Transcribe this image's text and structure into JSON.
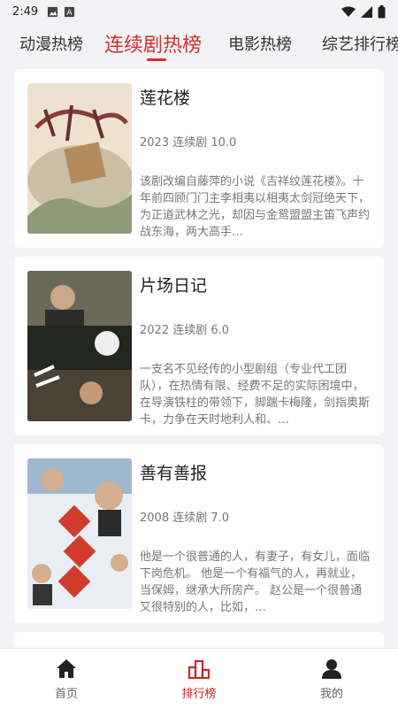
{
  "status_bar": {
    "time": "2:49",
    "icons": [
      "image-icon",
      "a-icon",
      "wifi-icon",
      "signal-icon",
      "battery-icon"
    ]
  },
  "tabs": [
    {
      "label": "动漫热榜",
      "active": false
    },
    {
      "label": "连续剧热榜",
      "active": true
    },
    {
      "label": "电影热榜",
      "active": false
    },
    {
      "label": "综艺排行榜",
      "active": false
    }
  ],
  "cards": [
    {
      "title": "莲花楼",
      "meta": "2023 连续剧 10.0",
      "description": "该剧改编自藤萍的小说《吉祥纹莲花楼》。十年前四顾门门主李相夷以相夷太剑冠绝天下，为正道武林之光，却因与金鸳盟盟主笛飞声约战东海，两大高手…"
    },
    {
      "title": "片场日记",
      "meta": "2022 连续剧 6.0",
      "description": "一支名不见经传的小型剧组（专业代工团队），在热情有限、经费不足的实际困境中，在导演铁柱的带领下，脚踹卡梅隆，剑指奥斯卡，力争在天时地利人和、…"
    },
    {
      "title": "善有善报",
      "meta": "2008 连续剧 7.0",
      "description": "他是一个很普通的人，有妻子，有女儿，面临下岗危机。 他是一个有福气的人，再就业，当保姆，继承大所房产。 赵公是一个很普通又很特别的人，比如，…"
    }
  ],
  "bottom_nav": [
    {
      "label": "首页",
      "icon": "home-icon",
      "active": false
    },
    {
      "label": "排行榜",
      "icon": "ranking-icon",
      "active": true
    },
    {
      "label": "我的",
      "icon": "user-icon",
      "active": false
    }
  ],
  "colors": {
    "accent": "#d32f2f",
    "background": "#f3f3f5"
  }
}
